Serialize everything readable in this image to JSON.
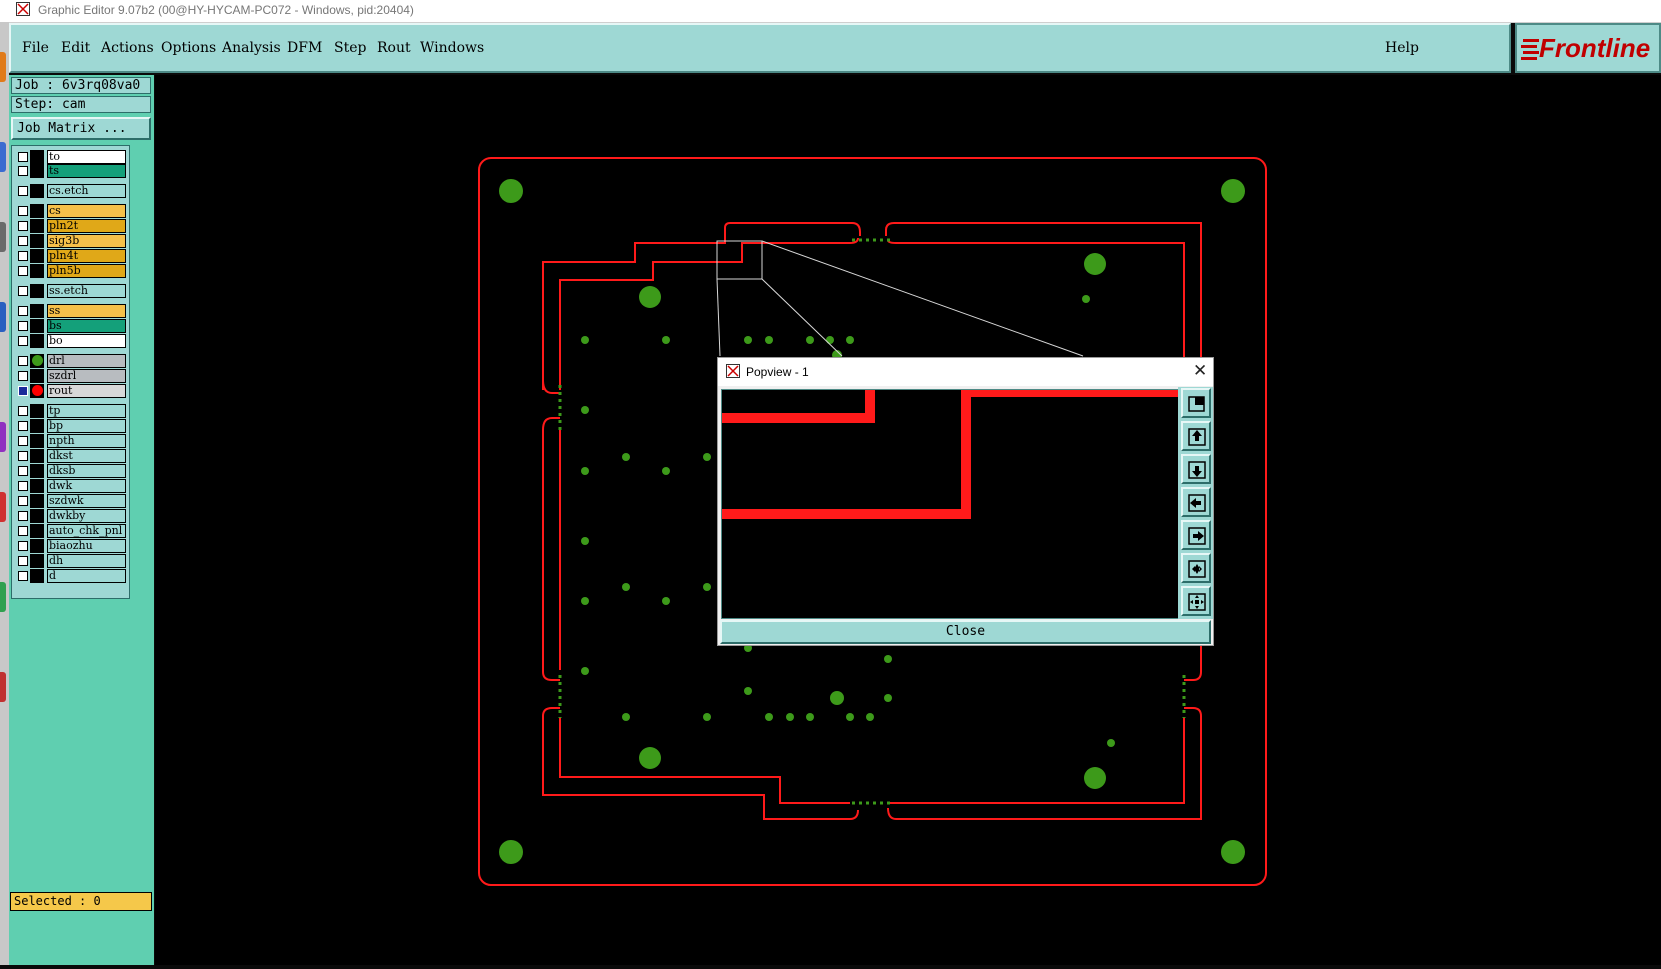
{
  "window": {
    "title": "Graphic Editor 9.07b2 (00@HY-HYCAM-PC072 - Windows, pid:20404)"
  },
  "menu": {
    "items": [
      "File",
      "Edit",
      "Actions",
      "Options",
      "Analysis",
      "DFM",
      "Step",
      "Rout",
      "Windows"
    ],
    "help": "Help"
  },
  "logo": {
    "text": "Frontline",
    "color": "#c00000"
  },
  "job": {
    "job_label": "Job : 6v3rq08va0",
    "step_label": "Step: cam",
    "matrix_button": "Job Matrix ..."
  },
  "layers": [
    {
      "name": "to",
      "color": "#ffffff"
    },
    {
      "name": "ts",
      "color": "#14a07a"
    },
    {
      "name": "cs.etch",
      "color": "#9ed8d4"
    },
    {
      "name": "cs",
      "color": "#f5c04a"
    },
    {
      "name": "pln2t",
      "color": "#e0a818"
    },
    {
      "name": "sig3b",
      "color": "#f5c04a"
    },
    {
      "name": "pln4t",
      "color": "#e0a818"
    },
    {
      "name": "pln5b",
      "color": "#e0a818"
    },
    {
      "name": "ss.etch",
      "color": "#9ed8d4"
    },
    {
      "name": "ss",
      "color": "#f5c04a"
    },
    {
      "name": "bs",
      "color": "#14a07a"
    },
    {
      "name": "bo",
      "color": "#ffffff"
    },
    {
      "name": "drl",
      "color": "#b8bcc0",
      "marker": "#3d9a1a"
    },
    {
      "name": "szdrl",
      "color": "#b8bcc0"
    },
    {
      "name": "rout",
      "color": "#d8d8d8",
      "marker": "#ff0000",
      "active": true
    },
    {
      "name": "tp",
      "color": "#9ed8d4"
    },
    {
      "name": "bp",
      "color": "#9ed8d4"
    },
    {
      "name": "npth",
      "color": "#9ed8d4"
    },
    {
      "name": "dkst",
      "color": "#9ed8d4"
    },
    {
      "name": "dksb",
      "color": "#9ed8d4"
    },
    {
      "name": "dwk",
      "color": "#9ed8d4"
    },
    {
      "name": "szdwk",
      "color": "#9ed8d4"
    },
    {
      "name": "dwkby",
      "color": "#9ed8d4"
    },
    {
      "name": "auto_chk_pnl",
      "color": "#9ed8d4"
    },
    {
      "name": "biaozhu",
      "color": "#9ed8d4"
    },
    {
      "name": "dh",
      "color": "#9ed8d4"
    },
    {
      "name": "d",
      "color": "#9ed8d4"
    }
  ],
  "status": {
    "selected": "Selected : 0"
  },
  "popview": {
    "title": "Popview - 1",
    "close_button": "Close",
    "tool_icons": [
      "zoom-home-icon",
      "pan-up-icon",
      "pan-down-icon",
      "pan-left-icon",
      "pan-right-icon",
      "zoom-in-icon",
      "zoom-out-icon"
    ]
  },
  "colors": {
    "panel": "#9ed8d4",
    "panel_green": "#5fcfb0",
    "rout": "#ff1a1a",
    "drill": "#3d9a1a"
  }
}
